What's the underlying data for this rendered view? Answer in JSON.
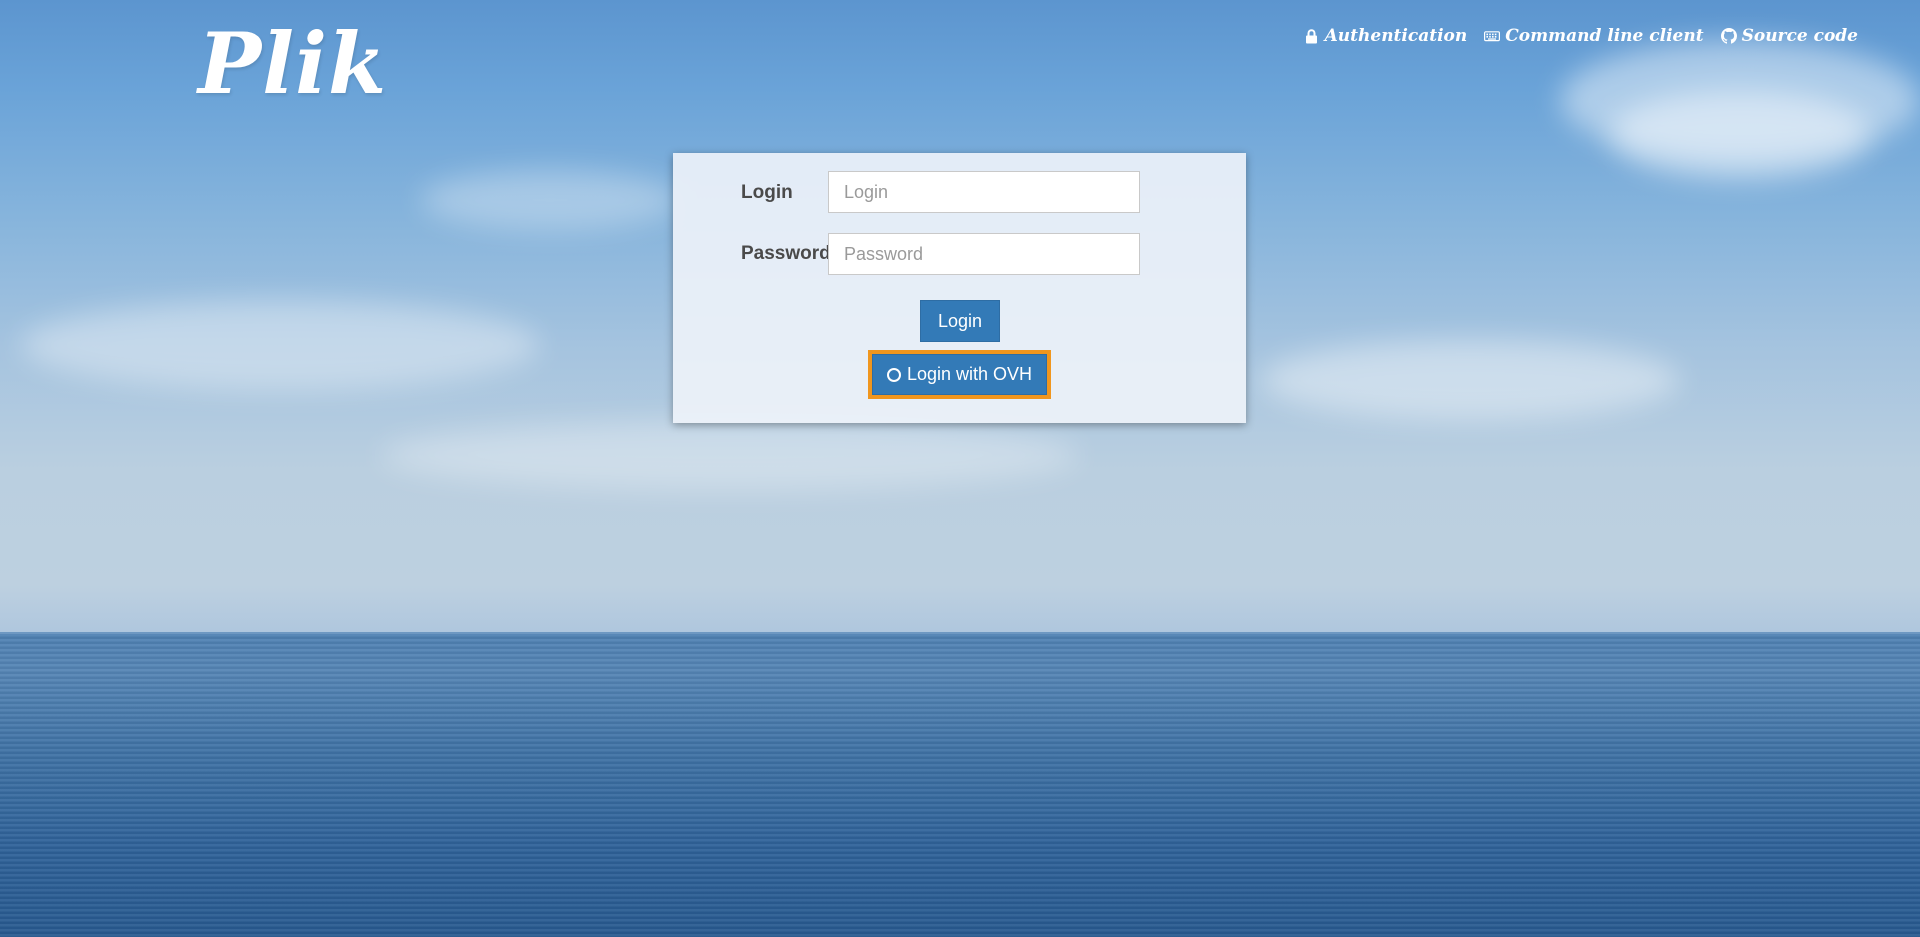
{
  "header": {
    "logo_text": "Plik",
    "nav": [
      {
        "label": "Authentication",
        "icon": "lock-icon"
      },
      {
        "label": "Command line client",
        "icon": "keyboard-icon"
      },
      {
        "label": "Source code",
        "icon": "github-icon"
      }
    ]
  },
  "login_form": {
    "login_label": "Login",
    "login_placeholder": "Login",
    "login_value": "",
    "password_label": "Password",
    "password_placeholder": "Password",
    "password_value": "",
    "login_button": "Login",
    "ovh_button": "Login with OVH",
    "ovh_icon": "circle-o-icon"
  },
  "colors": {
    "primary_button": "#337ab7",
    "focus_outline": "#f0961e"
  }
}
